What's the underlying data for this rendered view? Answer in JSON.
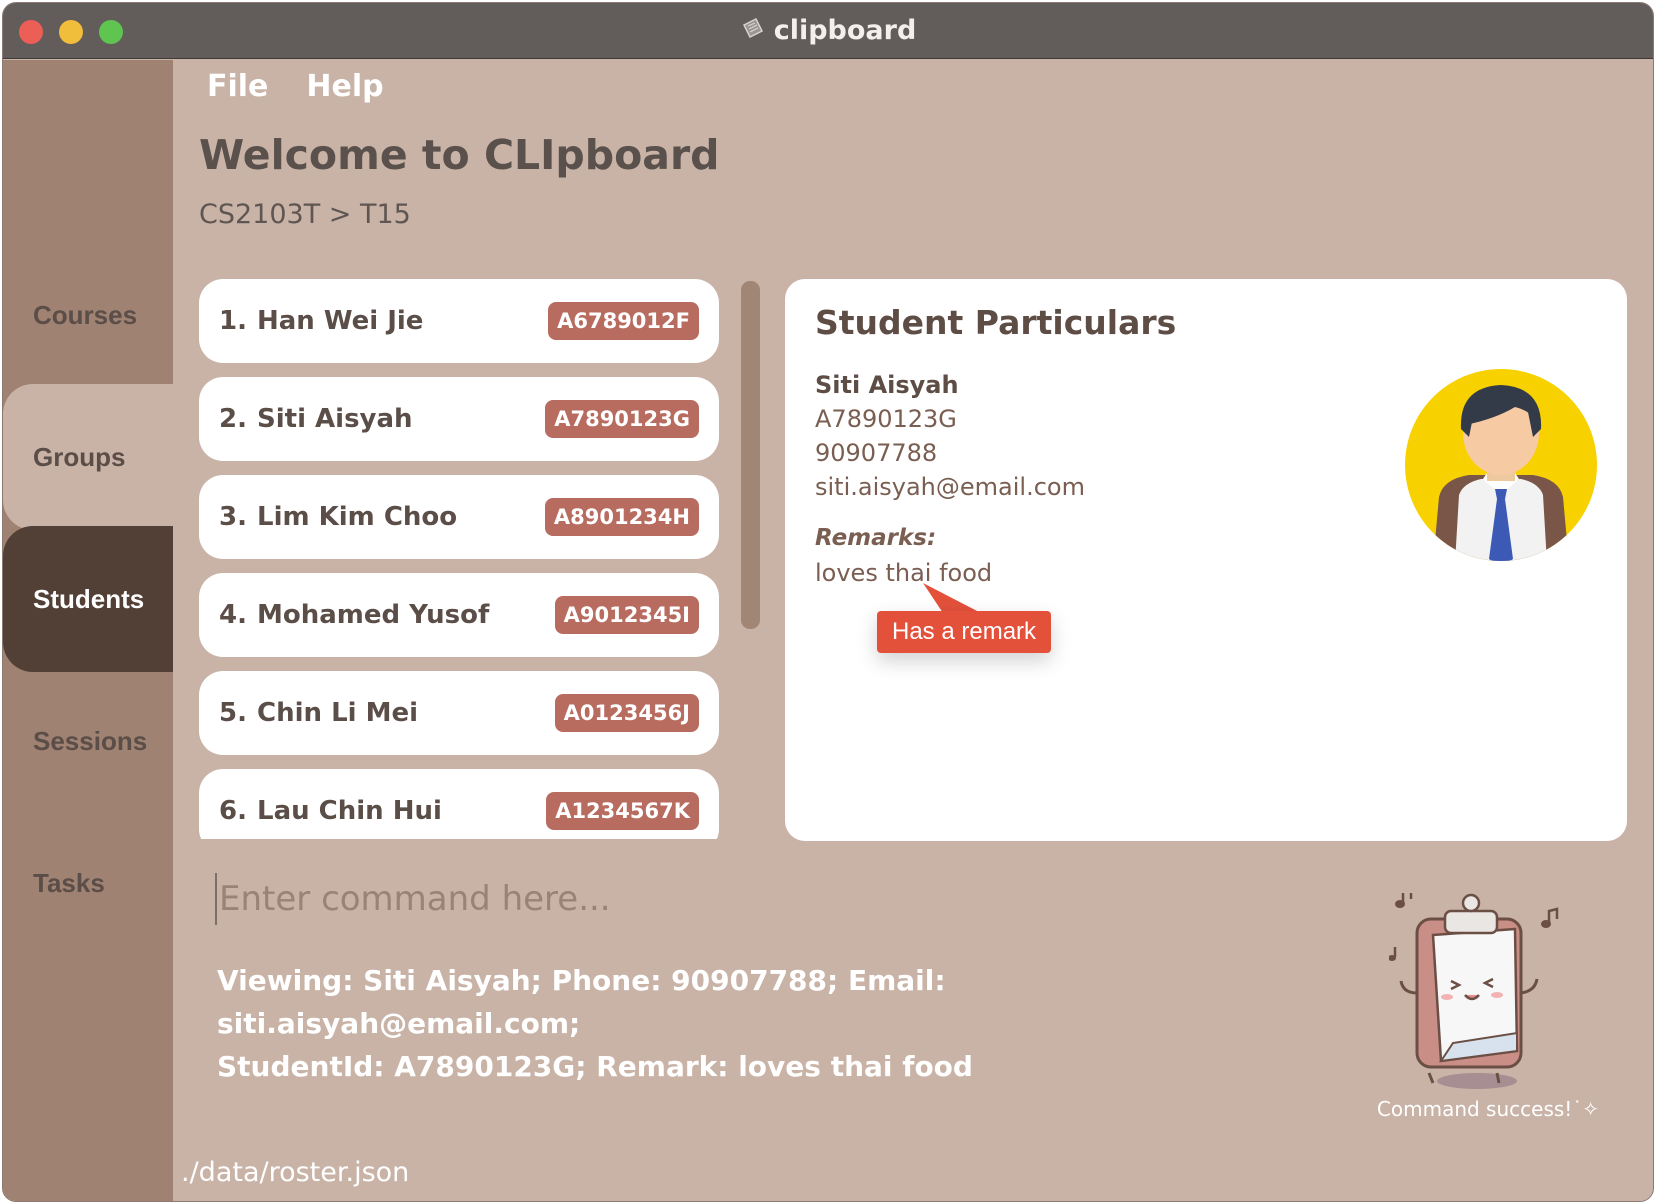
{
  "window": {
    "title": "clipboard",
    "accent_colors": {
      "badge": "#b86c60",
      "tooltip": "#e3513b",
      "sidebar": "#9f8272",
      "active_tab": "#524037"
    }
  },
  "menu": {
    "file": "File",
    "help": "Help"
  },
  "sidebar": {
    "items": [
      {
        "label": "Courses"
      },
      {
        "label": "Groups"
      },
      {
        "label": "Students"
      },
      {
        "label": "Sessions"
      },
      {
        "label": "Tasks"
      }
    ],
    "selected": "Students"
  },
  "header": {
    "welcome": "Welcome to CLIpboard",
    "breadcrumb": "CS2103T > T15"
  },
  "students": [
    {
      "index": "1.",
      "name": "Han Wei Jie",
      "id": "A6789012F"
    },
    {
      "index": "2.",
      "name": "Siti Aisyah",
      "id": "A7890123G"
    },
    {
      "index": "3.",
      "name": "Lim Kim Choo",
      "id": "A8901234H"
    },
    {
      "index": "4.",
      "name": "Mohamed Yusof",
      "id": "A9012345I"
    },
    {
      "index": "5.",
      "name": "Chin Li Mei",
      "id": "A0123456J"
    },
    {
      "index": "6.",
      "name": "Lau Chin Hui",
      "id": "A1234567K"
    }
  ],
  "particulars": {
    "title": "Student Particulars",
    "name": "Siti Aisyah",
    "student_id": "A7890123G",
    "phone": "90907788",
    "email": "siti.aisyah@email.com",
    "remarks_label": "Remarks:",
    "remark": "loves thai food",
    "avatar_icon": "student-avatar-icon"
  },
  "tooltip": {
    "text": "Has a remark"
  },
  "command": {
    "placeholder": "Enter command here...",
    "value": ""
  },
  "result": {
    "line1": "Viewing: Siti Aisyah; Phone: 90907788; Email: siti.aisyah@email.com;",
    "line2": "StudentId: A7890123G; Remark: loves thai food"
  },
  "mascot": {
    "caption": "Command success!˙✧",
    "icon": "clipboard-mascot-icon"
  },
  "status": {
    "path": "./data/roster.json"
  }
}
